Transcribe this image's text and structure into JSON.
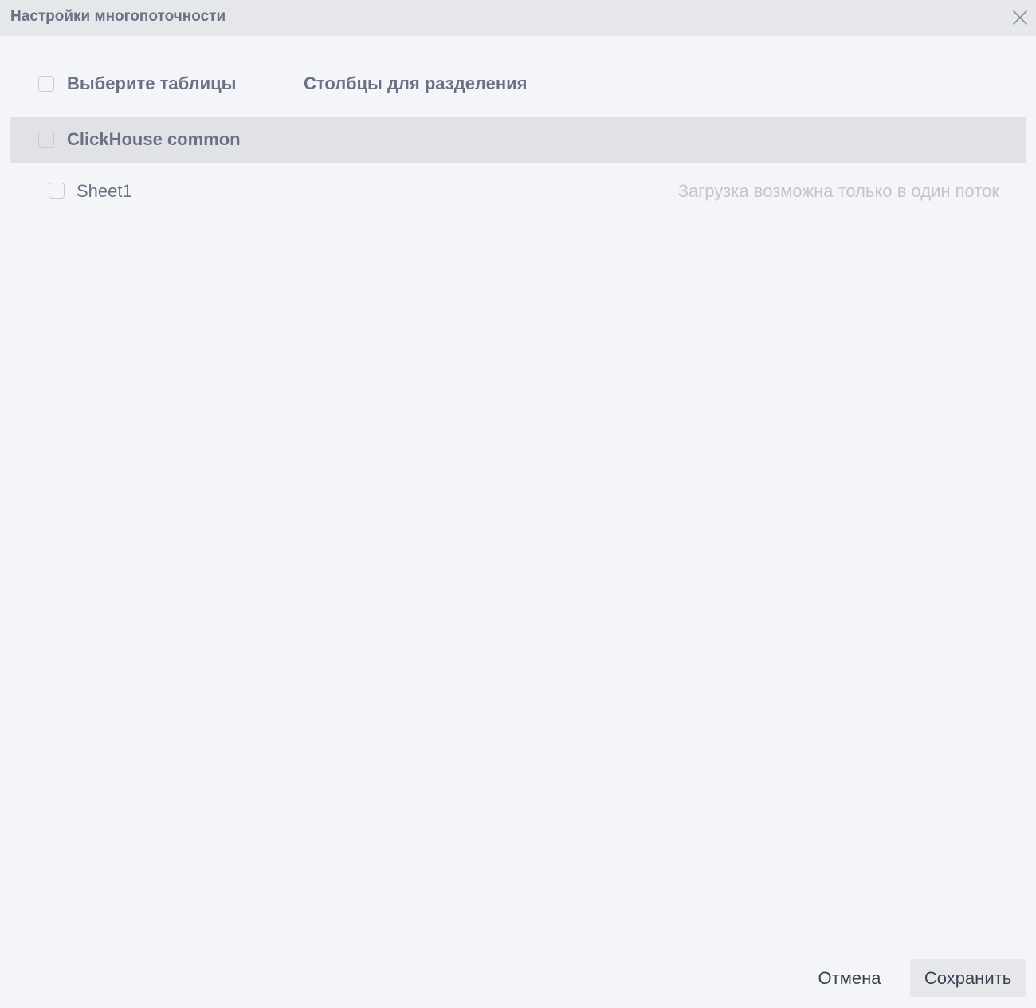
{
  "dialog": {
    "title": "Настройки многопоточности",
    "close_icon": "close-icon"
  },
  "columns": {
    "select_tables_label": "Выберите таблицы",
    "split_columns_label": "Столбцы для разделения"
  },
  "group": {
    "name": "ClickHouse common",
    "checked": false
  },
  "items": [
    {
      "name": "Sheet1",
      "checked": false,
      "hint": "Загрузка возможна только в один поток"
    }
  ],
  "footer": {
    "cancel_label": "Отмена",
    "save_label": "Сохранить"
  }
}
